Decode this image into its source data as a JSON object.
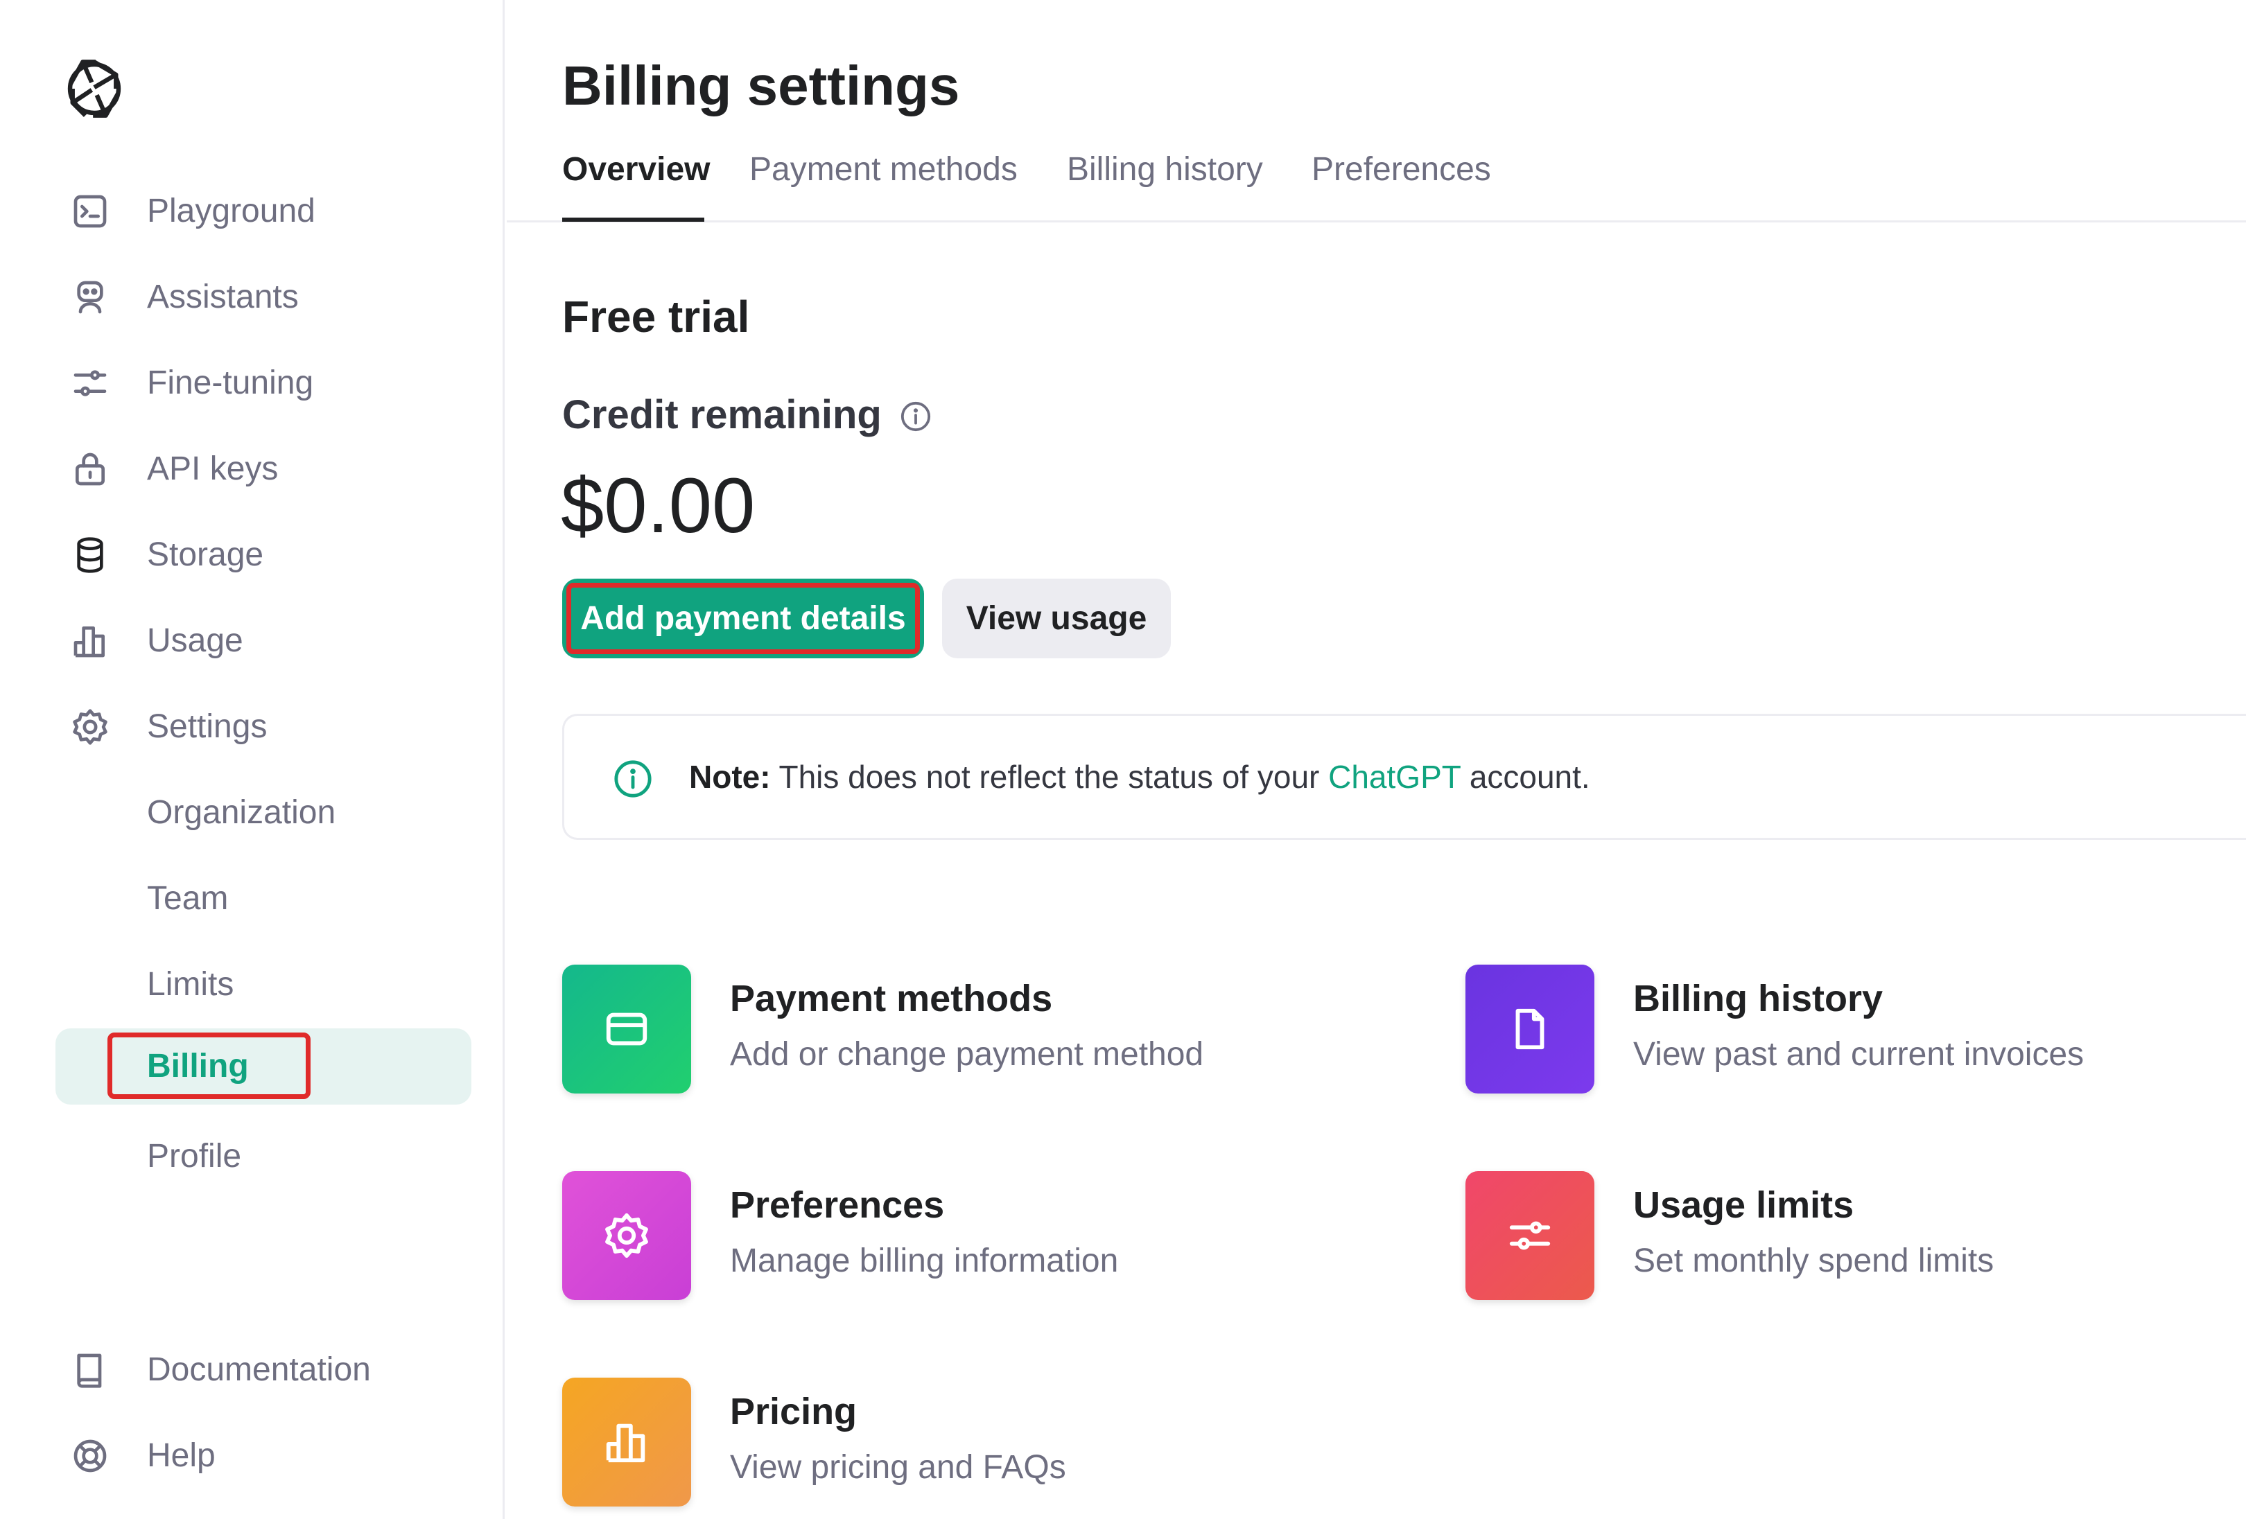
{
  "sidebar": {
    "items": [
      {
        "label": "Playground",
        "icon": "terminal-icon"
      },
      {
        "label": "Assistants",
        "icon": "robot-icon"
      },
      {
        "label": "Fine-tuning",
        "icon": "sliders-icon"
      },
      {
        "label": "API keys",
        "icon": "lock-icon"
      },
      {
        "label": "Storage",
        "icon": "database-icon"
      },
      {
        "label": "Usage",
        "icon": "bar-chart-icon"
      },
      {
        "label": "Settings",
        "icon": "gear-icon"
      }
    ],
    "sub_items": [
      {
        "label": "Organization"
      },
      {
        "label": "Team"
      },
      {
        "label": "Limits"
      },
      {
        "label": "Billing",
        "active": true
      },
      {
        "label": "Profile"
      }
    ],
    "footer": [
      {
        "label": "Documentation",
        "icon": "book-icon"
      },
      {
        "label": "Help",
        "icon": "lifebuoy-icon"
      }
    ]
  },
  "main": {
    "title": "Billing settings",
    "tabs": [
      {
        "label": "Overview",
        "active": true
      },
      {
        "label": "Payment methods"
      },
      {
        "label": "Billing history"
      },
      {
        "label": "Preferences"
      }
    ],
    "section_title": "Free trial",
    "credit_label": "Credit remaining",
    "credit_value": "$0.00",
    "primary_button": "Add payment details",
    "secondary_button": "View usage",
    "note": {
      "label": "Note:",
      "text_before": "This does not reflect the status of your",
      "link": "ChatGPT",
      "text_after": "account."
    },
    "cards": [
      {
        "title": "Payment methods",
        "desc": "Add or change payment method",
        "icon": "credit-card-icon",
        "color": "#19c37d"
      },
      {
        "title": "Billing history",
        "desc": "View past and current invoices",
        "icon": "document-icon",
        "color": "#6e3ce6"
      },
      {
        "title": "Preferences",
        "desc": "Manage billing information",
        "icon": "gear-icon",
        "color": "#d946d3"
      },
      {
        "title": "Usage limits",
        "desc": "Set monthly spend limits",
        "icon": "sliders-icon",
        "color": "#ef4146"
      },
      {
        "title": "Pricing",
        "desc": "View pricing and FAQs",
        "icon": "bar-chart-icon",
        "color": "#f4ac36"
      }
    ]
  },
  "colors": {
    "accent": "#10a37f",
    "highlight": "#e02a2a"
  }
}
